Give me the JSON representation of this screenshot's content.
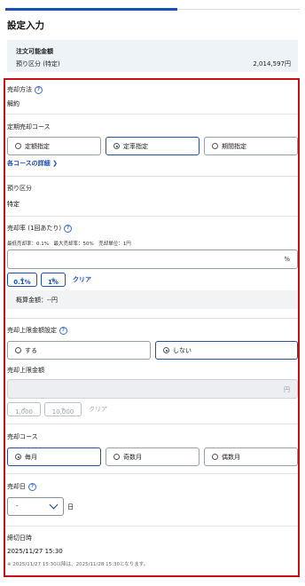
{
  "page": {
    "title": "設定入力"
  },
  "summary": {
    "label": "注文可能金額",
    "sub_label": "預り区分 (特定)",
    "amount": "2,014,597円"
  },
  "sell_method": {
    "label": "売却方法",
    "value": "解約"
  },
  "course": {
    "label": "定期売却コース",
    "options": [
      {
        "label": "定額指定",
        "selected": false
      },
      {
        "label": "定率指定",
        "selected": true
      },
      {
        "label": "期間指定",
        "selected": false
      }
    ],
    "details_link": "各コースの詳細"
  },
  "custody": {
    "label": "預り区分",
    "value": "特定"
  },
  "rate": {
    "label": "売却率 (1回あたり)",
    "note": "最低売却率：0.1%　最大売却率：50%　売却単位：1円",
    "unit": "%",
    "btn_small": "0.1%",
    "btn_large": "1%",
    "clear": "クリア"
  },
  "estimate": {
    "text": "概算金額：--円"
  },
  "limit_setting": {
    "label": "売却上限金額設定",
    "options": [
      {
        "label": "する",
        "selected": false
      },
      {
        "label": "しない",
        "selected": true
      }
    ]
  },
  "limit_amount": {
    "label": "売却上限金額",
    "unit": "円",
    "btn_small": "1,000",
    "btn_large": "10,000",
    "clear": "クリア"
  },
  "sell_course": {
    "label": "売却コース",
    "options": [
      {
        "label": "毎月",
        "selected": true
      },
      {
        "label": "奇数月",
        "selected": false
      },
      {
        "label": "偶数月",
        "selected": false
      }
    ]
  },
  "sell_day": {
    "label": "売却日",
    "value": "-",
    "suffix": "日"
  },
  "deadline": {
    "label": "締切日時",
    "value": "2025/11/27 15:30",
    "note": "※ 2025/11/27 15:30以降は、2025/11/28 15:30となります。"
  }
}
